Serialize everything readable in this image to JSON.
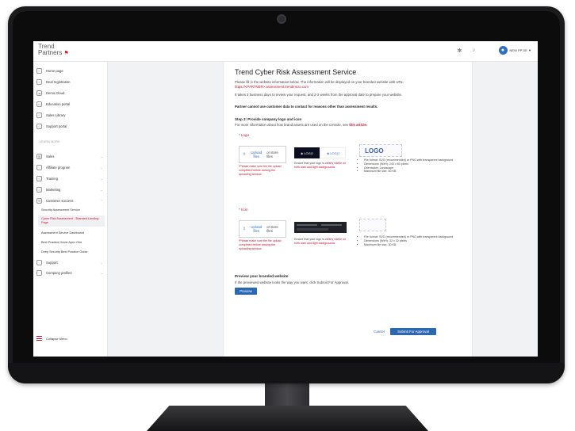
{
  "header": {
    "brand_line1": "Trend",
    "brand_line2": "Partners",
    "user_label": "NEW PP DE ▼"
  },
  "sidebar": {
    "items": [
      {
        "label": "Home page",
        "icon": "home-icon"
      },
      {
        "label": "Deal registration",
        "icon": "handshake-icon"
      },
      {
        "label": "Demo Cloud",
        "icon": "cloud-icon"
      },
      {
        "label": "Education portal",
        "icon": "education-icon"
      },
      {
        "label": "Sales Library",
        "icon": "library-icon"
      },
      {
        "label": "Support portal",
        "icon": "support-icon"
      }
    ],
    "section_label": "LEARN MORE",
    "groups": [
      {
        "label": "Sales",
        "icon": "chart-icon"
      },
      {
        "label": "Affiliate program",
        "icon": "affiliate-icon"
      },
      {
        "label": "Training",
        "icon": "training-icon"
      },
      {
        "label": "Marketing",
        "icon": "marketing-icon"
      },
      {
        "label": "Customer success",
        "icon": "customer-success-icon"
      }
    ],
    "sub_items": [
      {
        "label": "Security Assessment Service"
      },
      {
        "label": "Cyber Risk Assessment - Branded Landing Page"
      },
      {
        "label": "Assessment Service Dashboard"
      },
      {
        "label": "Best Practice Guide Apex One"
      },
      {
        "label": "Deep Security Best Practice Guide"
      }
    ],
    "more_groups": [
      {
        "label": "Support",
        "icon": "support-icon"
      },
      {
        "label": "Company profiles",
        "icon": "company-icon"
      }
    ],
    "collapse_label": "Collapse Menu"
  },
  "main": {
    "title": "Trend Cyber Risk Assessment Service",
    "intro_text": "Please fill in the website information below. The information will be displayed on your branded website with URL:",
    "intro_url": "https://<PARTNER>.assessment.trendmicro.com",
    "review_text": "It takes 3 business days to review your request, and 2-3 weeks from the approval date to prepare your website.",
    "warning_text": "Partner cannot use customer data to contact for reasons other than assessment results.",
    "step_title": "Step 3: Provide company logo and icon",
    "step_sub": "For more information about how brand assets are used on the console, see",
    "step_link": "this article.",
    "logo_section": {
      "label": "* Logo",
      "upload_link": "Upload files",
      "upload_or": "or store files",
      "warning": "*Please make sure the file upload completed before closing the uploading window.",
      "preview_note_a": "Ensure that your logo is",
      "preview_note_link": "clearly visible on both dark and light backgrounds",
      "preview_note_b": ".",
      "sample_logo_text": "LOGO",
      "specs": [
        "File format: SVG (recommended) or PNG with transparent background",
        "Dimensions (WxH): 240 x 80 pixels",
        "Orientation: Landscape",
        "Maximum file size: 50 KB"
      ]
    },
    "icon_section": {
      "label": "* Icon",
      "upload_link": "Upload files",
      "upload_or": "or store files",
      "warning": "*Please make sure the file upload completed before closing the uploading window.",
      "preview_note_a": "Ensure that your logo is",
      "preview_note_link": "clearly visible on both dark and light backgrounds",
      "preview_note_b": ".",
      "specs": [
        "File format: SVG (recommended) or PNG with transparent background",
        "Dimensions (WxH): 32 x 32 pixels",
        "Maximum file size: 30 KB"
      ]
    },
    "preview": {
      "title": "Preview your branded website",
      "sub": "If the previewed website looks the way you want, click Submit For Approval.",
      "button": "Preview"
    },
    "actions": {
      "cancel": "Cancel",
      "submit": "Submit For Approval"
    }
  },
  "colors": {
    "accent": "#c8102e",
    "primary": "#2c67b4"
  }
}
